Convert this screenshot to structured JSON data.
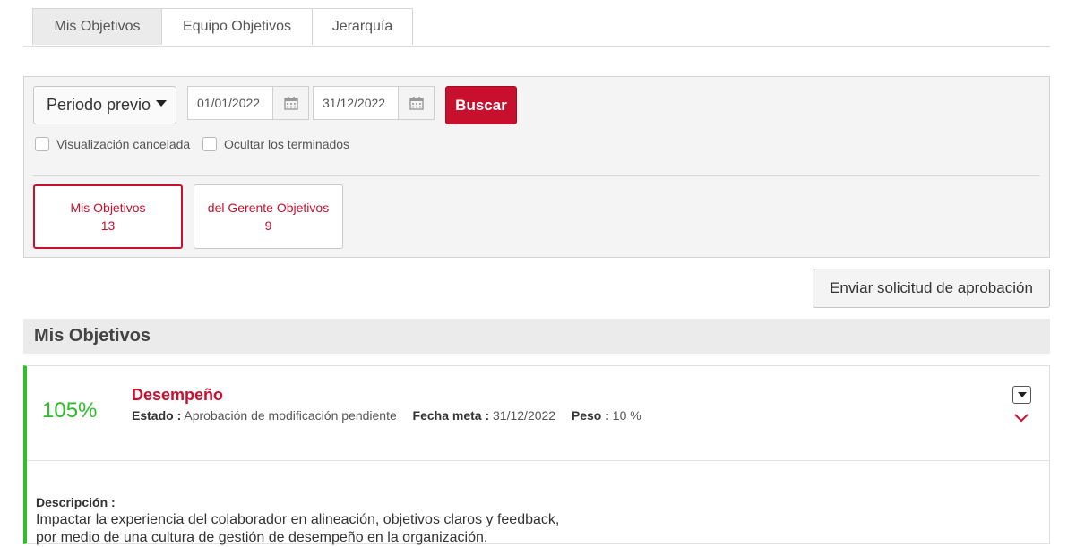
{
  "tabs": [
    {
      "label": "Mis Objetivos"
    },
    {
      "label": "Equipo Objetivos"
    },
    {
      "label": "Jerarquía"
    }
  ],
  "filters": {
    "period_label": "Periodo previo",
    "date_from": "01/01/2022",
    "date_to": "31/12/2022",
    "search_label": "Buscar",
    "checkbox_cancelled": "Visualización cancelada",
    "checkbox_hide_finished": "Ocultar los terminados"
  },
  "summary_cards": [
    {
      "label": "Mis Objetivos",
      "count": "13"
    },
    {
      "label": "del Gerente Objetivos",
      "count": "9"
    }
  ],
  "approval_button": "Enviar solicitud de aprobación",
  "section_title": "Mis Objetivos",
  "objective": {
    "percent": "105%",
    "title": "Desempeño",
    "status_label": "Estado :",
    "status_value": "Aprobación de modificación pendiente",
    "due_label": "Fecha meta :",
    "due_value": "31/12/2022",
    "weight_label": "Peso :",
    "weight_value": "10 %",
    "description_label": "Descripción :",
    "description_line1": "Impactar la experiencia del colaborador en alineación, objetivos claros y feedback,",
    "description_line2": "por medio de una cultura de gestión de desempeño en la organización."
  },
  "colors": {
    "accent": "#c8102e",
    "success": "#2ebd2a"
  },
  "icons": [
    "calendar-icon",
    "caret-down-icon",
    "chevron-down-icon"
  ]
}
